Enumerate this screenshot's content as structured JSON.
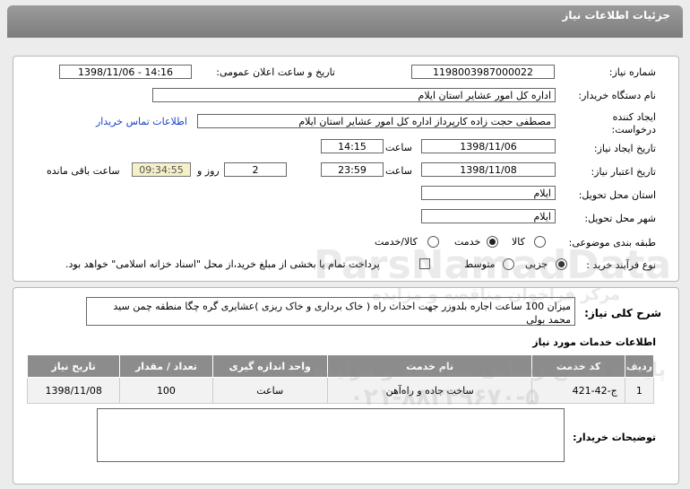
{
  "header": {
    "title": "جزئیات اطلاعات نیاز"
  },
  "labels": {
    "need_number": "شماره نیاز:",
    "announce_datetime": "تاریخ و ساعت اعلان عمومی:",
    "buyer_org": "نام دستگاه خریدار:",
    "creator": "ایجاد کننده درخواست:",
    "contact_link": "اطلاعات تماس خریدار",
    "need_date": "تاریخ ایجاد نیاز:",
    "time_word": "ساعت",
    "validity_date": "تاریخ اعتبار نیاز:",
    "day_and": "روز و",
    "remaining": "ساعت باقی مانده",
    "province": "استان محل تحویل:",
    "city": "شهر محل تحویل:",
    "category": "طبقه بندی موضوعی:",
    "process": "نوع فرآیند خرید :",
    "description": "شرح کلی نیاز:",
    "services_title": "اطلاعات خدمات مورد نیاز",
    "buyer_notes": "توضیحات خریدار:"
  },
  "values": {
    "need_number": "1198003987000022",
    "announce_datetime": "1398/11/06 - 14:16",
    "buyer_org": "اداره کل امور عشایر استان ایلام",
    "creator": "مصطفی حجت زاده کارپرداز اداره کل امور عشایر استان ایلام",
    "need_date": "1398/11/06",
    "need_time": "14:15",
    "validity_date": "1398/11/08",
    "validity_time": "23:59",
    "days": "2",
    "remaining_time": "09:34:55",
    "province": "ایلام",
    "city": "ایلام",
    "description": "میزان 100 ساعت اجاره بلدوزر جهت احداث راه ( خاک برداری و خاک ریزی )عشایری گره چگا منطقه چمن سید محمد بولی",
    "buyer_notes": ""
  },
  "category_options": [
    {
      "label": "کالا",
      "selected": false
    },
    {
      "label": "خدمت",
      "selected": true
    },
    {
      "label": "کالا/خدمت",
      "selected": false
    }
  ],
  "process_options": [
    {
      "label": "جزیی",
      "selected": true
    },
    {
      "label": "متوسط",
      "selected": false
    }
  ],
  "process_note": "پرداخت تمام یا بخشی از مبلغ خرید،از محل \"اسناد خزانه اسلامی\" خواهد بود.",
  "table": {
    "headers": [
      "ردیف",
      "کد خدمت",
      "نام خدمت",
      "واحد اندازه گیری",
      "تعداد / مقدار",
      "تاریخ نیاز"
    ],
    "rows": [
      [
        "1",
        "ج-42-421",
        "ساخت جاده و راه‌آهن",
        "ساعت",
        "100",
        "1398/11/08"
      ]
    ]
  },
  "watermark": {
    "brand": "ParsNamadData",
    "line1": "پایگاه اطلاع رسانی مناقصه و مزایده",
    "line2": "۰۲۱-۸۸۳۴۹۶۷۰-۵",
    "line3": "مرکز فراخوان مناقصه و مزایده"
  }
}
